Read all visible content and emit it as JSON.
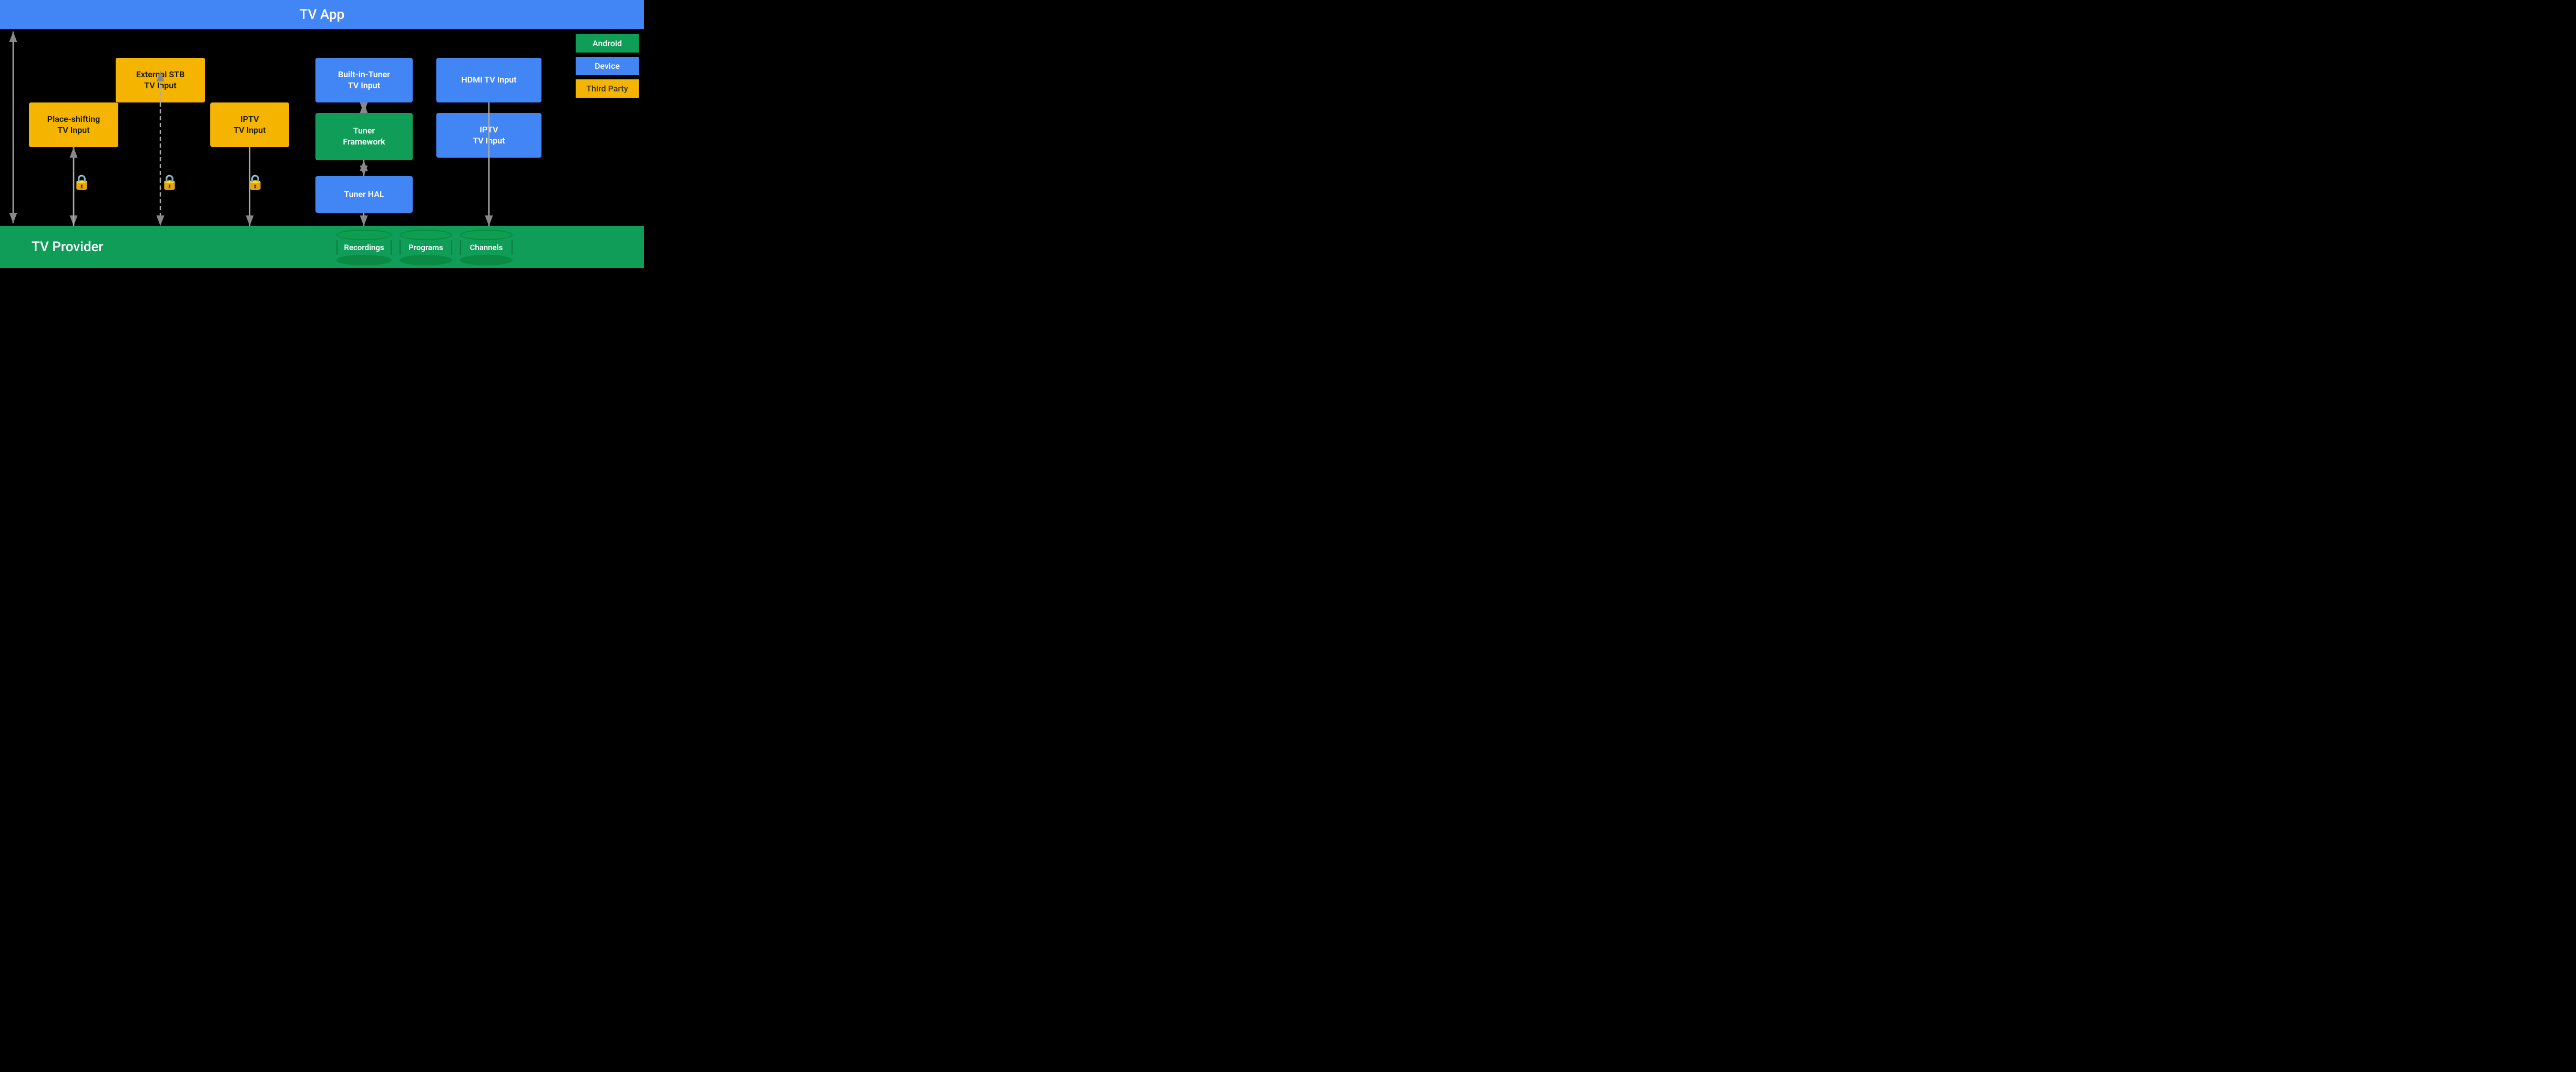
{
  "header": {
    "tv_app_label": "TV App"
  },
  "footer": {
    "tv_provider_label": "TV Provider"
  },
  "legend": {
    "android_label": "Android",
    "device_label": "Device",
    "third_party_label": "Third Party"
  },
  "boxes": {
    "place_shifting": "Place-shifting\nTV Input",
    "external_stb": "External STB\nTV Input",
    "iptv_left": "IPTV\nTV Input",
    "built_in_tuner": "Built-in-Tuner\nTV Input",
    "tuner_framework": "Tuner\nFramework",
    "tuner_hal": "Tuner HAL",
    "hdmi_tv_input": "HDMI TV Input",
    "iptv_right": "IPTV\nTV Input"
  },
  "databases": {
    "recordings": "Recordings",
    "programs": "Programs",
    "channels": "Channels"
  },
  "colors": {
    "black": "#000000",
    "blue": "#4285F4",
    "green": "#0F9D58",
    "orange": "#F4B400",
    "white": "#FFFFFF"
  }
}
